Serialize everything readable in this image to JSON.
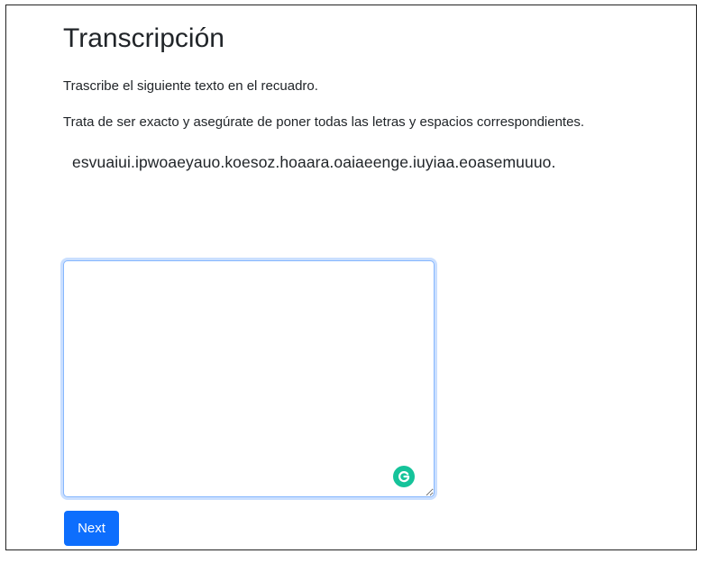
{
  "page": {
    "title": "Transcripción",
    "instruction_1": "Trascribe el siguiente texto en el recuadro.",
    "instruction_2": "Trata de ser exacto y asegúrate de poner todas las letras y espacios correspondientes.",
    "target_text": "esvuaiui.ipwoaeyauo.koesoz.hoaara.oaiaeenge.iuyiaa.eoasemuuuo."
  },
  "answer": {
    "value": "",
    "placeholder": ""
  },
  "grammarly": {
    "icon": "grammarly-icon",
    "color": "#15c39a"
  },
  "actions": {
    "next_label": "Next",
    "next_color": "#0d6efd"
  }
}
